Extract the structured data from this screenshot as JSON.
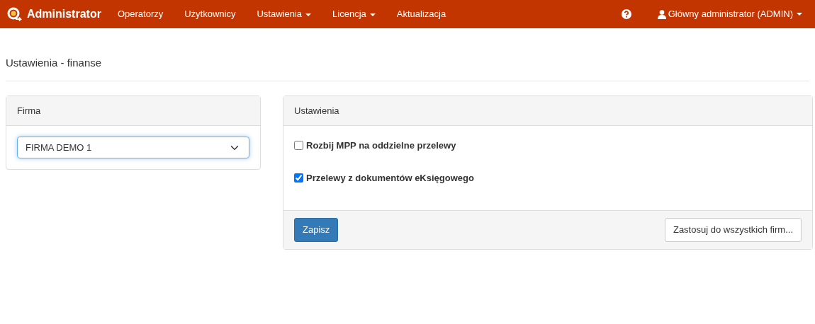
{
  "navbar": {
    "brand": "Administrator",
    "items": [
      {
        "label": "Operatorzy",
        "dropdown": false
      },
      {
        "label": "Użytkownicy",
        "dropdown": false
      },
      {
        "label": "Ustawienia",
        "dropdown": true
      },
      {
        "label": "Licencja",
        "dropdown": true
      },
      {
        "label": "Aktualizacja",
        "dropdown": false
      }
    ],
    "user": {
      "label": "Główny administrator (ADMIN)",
      "dropdown": true
    }
  },
  "page_title": "Ustawienia - finanse",
  "company_panel": {
    "title": "Firma",
    "select": {
      "value": "FIRMA DEMO 1",
      "focused": true
    }
  },
  "settings_panel": {
    "title": "Ustawienia",
    "options": [
      {
        "label": "Rozbij MPP na oddzielne przelewy",
        "checked": false
      },
      {
        "label": "Przelewy z dokumentów eKsięgowego",
        "checked": true
      }
    ],
    "buttons": [
      {
        "label": "Zapisz",
        "kind": "primary"
      },
      {
        "label": "Zastosuj do wszystkich firm...",
        "kind": "default"
      }
    ]
  }
}
